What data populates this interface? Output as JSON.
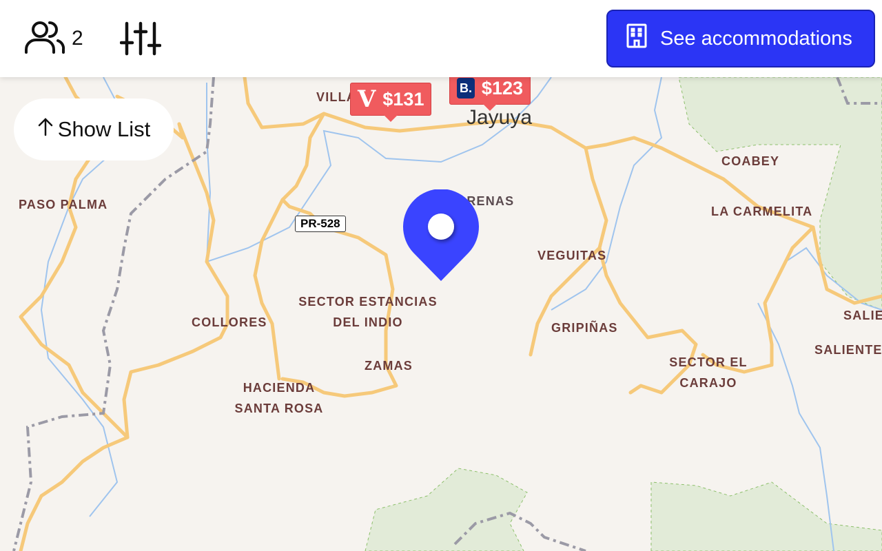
{
  "header": {
    "guest_count": "2",
    "cta_label": "See accommodations",
    "icons": {
      "guests": "users-icon",
      "filters": "sliders-icon",
      "cta": "building-icon"
    }
  },
  "map": {
    "show_list_label": "Show List",
    "road_label": "PR-528",
    "town": "Jayuya",
    "places": {
      "villa": "VILLA",
      "las_arenas": "LAS ARENAS",
      "coabey": "COABEY",
      "la_carmelita": "LA CARMELITA",
      "paso_palma": "PASO PALMA",
      "veguitas": "VEGUITAS",
      "sector_estancias_line1": "SECTOR ESTANCIAS",
      "sector_estancias_line2": "DEL INDIO",
      "collores": "COLLORES",
      "gripinas": "GRIPIÑAS",
      "salie": "SALIE",
      "saliente": "SALIENTE",
      "zamas": "ZAMAS",
      "sector_el_line1": "SECTOR EL",
      "sector_el_line2": "CARAJO",
      "hacienda_line1": "HACIENDA",
      "hacienda_line2": "SANTA ROSA"
    },
    "prices": [
      {
        "amount": "$131",
        "provider_logo": "V"
      },
      {
        "amount": "$123",
        "provider_logo": "B."
      }
    ],
    "colors": {
      "accent": "#2b35f5",
      "pin": "#3a44ff",
      "price": "#f05b5e",
      "road": "#f6c97a",
      "water": "#9fc4ee",
      "park": "#e2ebd8"
    }
  }
}
